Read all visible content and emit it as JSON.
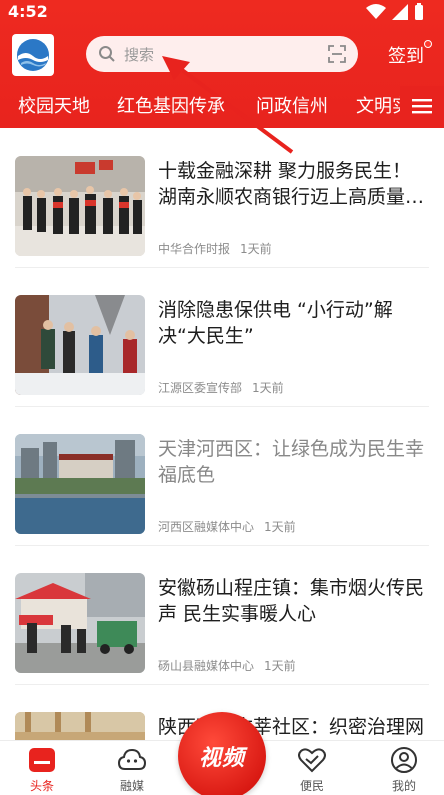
{
  "status_bar": {
    "time": "4:52"
  },
  "header": {
    "search_placeholder": "搜索",
    "signin_label": "签到"
  },
  "nav": {
    "tabs": [
      "校园天地",
      "红色基因传承",
      "问政信州",
      "文明实践"
    ]
  },
  "news": [
    {
      "title": "十载金融深耕 聚力服务民生！湖南永顺农商银行迈上高质量发展新台阶",
      "source": "中华合作时报",
      "time": "1天前",
      "read": false
    },
    {
      "title": "消除隐患保供电 “小行动”解决“大民生”",
      "source": "江源区委宣传部",
      "time": "1天前",
      "read": false
    },
    {
      "title": "天津河西区：让绿色成为民生幸福底色",
      "source": "河西区融媒体中心",
      "time": "1天前",
      "read": true
    },
    {
      "title": "安徽砀山程庄镇：集市烟火传民声 民生实事暖人心",
      "source": "砀山县融媒体中心",
      "time": "1天前",
      "read": false
    },
    {
      "title": "陕西西安古莘社区：织密治理网络",
      "source": "",
      "time": "",
      "read": false
    }
  ],
  "tabbar": {
    "headlines": "头条",
    "media": "融媒",
    "video": "视频",
    "convenience": "便民",
    "mine": "我的"
  },
  "colors": {
    "brand_red": "#e8231e"
  }
}
